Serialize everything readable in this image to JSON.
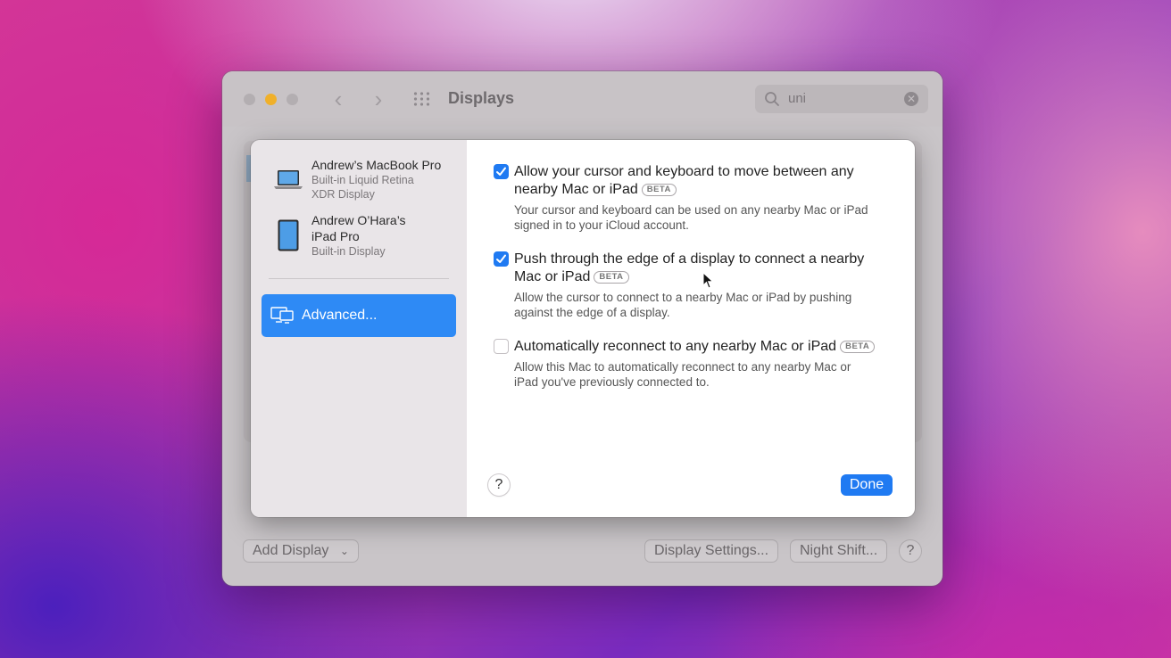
{
  "window": {
    "title": "Displays",
    "search": {
      "value": "uni"
    }
  },
  "sidebar": {
    "devices": [
      {
        "name": "Andrew’s MacBook Pro",
        "subtitle_line1": "Built-in Liquid Retina",
        "subtitle_line2": "XDR Display",
        "icon": "laptop-icon"
      },
      {
        "name_line1": "Andrew O’Hara’s",
        "name_line2": "iPad Pro",
        "subtitle": "Built-in Display",
        "icon": "ipad-icon"
      }
    ],
    "advanced_label": "Advanced..."
  },
  "options": [
    {
      "checked": true,
      "title_line1": "Allow your cursor and keyboard to move between any",
      "title_line2": "nearby Mac or iPad",
      "beta": "BETA",
      "desc_line1": "Your cursor and keyboard can be used on any nearby Mac or iPad",
      "desc_line2": "signed in to your iCloud account."
    },
    {
      "checked": true,
      "title_line1": "Push through the edge of a display to connect a nearby",
      "title_line2": "Mac or iPad",
      "beta": "BETA",
      "desc_line1": "Allow the cursor to connect to a nearby Mac or iPad by pushing",
      "desc_line2": "against the edge of a display."
    },
    {
      "checked": false,
      "title_line1": "Automatically reconnect to any nearby Mac or iPad",
      "beta": "BETA",
      "desc_line1": "Allow this Mac to automatically reconnect to any nearby Mac or",
      "desc_line2": "iPad you've previously connected to."
    }
  ],
  "sheet": {
    "help_label": "?",
    "done_label": "Done"
  },
  "footer": {
    "add_display": "Add Display",
    "display_settings": "Display Settings...",
    "night_shift": "Night Shift...",
    "help_label": "?"
  },
  "colors": {
    "accent": "#1f7af2",
    "selection": "#2e8af5",
    "minimize": "#f0b02a"
  }
}
